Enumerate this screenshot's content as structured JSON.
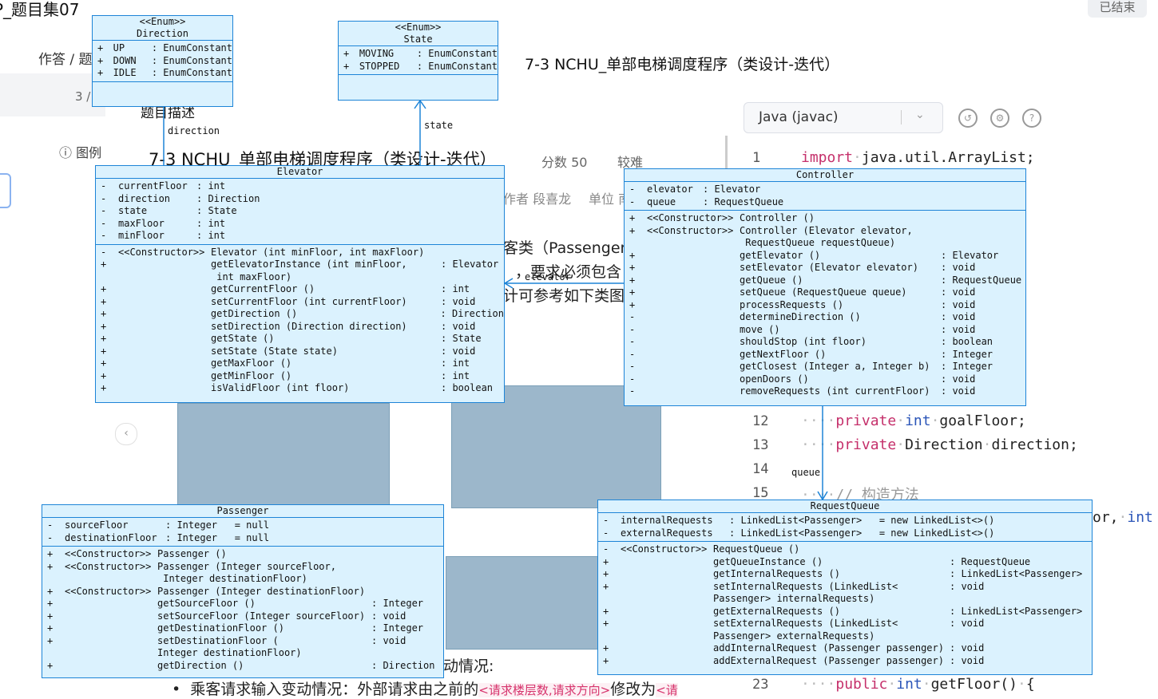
{
  "page": {
    "exam_title": "P_题目集07",
    "ended_label": "已结束",
    "breadcrumb": "作答 / 题",
    "pager": "3 /",
    "example_nav": "图例",
    "heading": "7-3 NCHU_单部电梯调度程序（类设计-迭代）",
    "desc_heading": "题目描述",
    "problem_title": "7-3 NCHU_单部电梯调度程序（类设计-迭代）",
    "score": "分数 50",
    "difficulty": "较难",
    "author": "作者 段喜龙",
    "unit": "单位 南",
    "frag1": "客类（Passenger",
    "frag2": "，要求必须包含",
    "frag3": "计可参考如下类图",
    "frag_dyn": "动情况:",
    "bullet_text": "乘客请求输入变动情况：外部请求由之前的",
    "bullet_tag": "<请求楼层数,请求方向>",
    "bullet_after": "修改为",
    "bullet_tag2": "<请"
  },
  "editor": {
    "language": "Java (javac)",
    "lines": [
      {
        "n": "1",
        "code": "import java.util.ArrayList;"
      },
      {
        "n": "12",
        "code": "private int goalFloor;"
      },
      {
        "n": "13",
        "code": "private Direction direction;"
      },
      {
        "n": "14",
        "code": ""
      },
      {
        "n": "15",
        "code": "// 构造方法"
      },
      {
        "n": "23",
        "code": "public int getFloor() {"
      }
    ],
    "right_frag": "or, int"
  },
  "uml": {
    "direction": {
      "stereotype": "<<Enum>>",
      "name": "Direction",
      "attrs": [
        {
          "v": "+",
          "n": "UP",
          "t": ": EnumConstant"
        },
        {
          "v": "+",
          "n": "DOWN",
          "t": ": EnumConstant"
        },
        {
          "v": "+",
          "n": "IDLE",
          "t": ": EnumConstant"
        }
      ]
    },
    "state": {
      "stereotype": "<<Enum>>",
      "name": "State",
      "attrs": [
        {
          "v": "+",
          "n": "MOVING",
          "t": ": EnumConstant"
        },
        {
          "v": "+",
          "n": "STOPPED",
          "t": ": EnumConstant"
        }
      ]
    },
    "elevator": {
      "name": "Elevator",
      "attrs": [
        {
          "v": "-",
          "n": "currentFloor",
          "t": ": int"
        },
        {
          "v": "-",
          "n": "direction",
          "t": ": Direction"
        },
        {
          "v": "-",
          "n": "state",
          "t": ": State"
        },
        {
          "v": "-",
          "n": "maxFloor",
          "t": ": int"
        },
        {
          "v": "-",
          "n": "minFloor",
          "t": ": int"
        }
      ],
      "methods": [
        {
          "v": "-",
          "m": "<<Constructor>>",
          "s": "Elevator (int minFloor, int maxFloor)",
          "r": ""
        },
        {
          "v": "+",
          "m": "",
          "s": "getElevatorInstance (int minFloor,",
          "r": ": Elevator"
        },
        {
          "v": "",
          "m": "",
          "s": " int maxFloor)",
          "r": ""
        },
        {
          "v": "+",
          "m": "",
          "s": "getCurrentFloor ()",
          "r": ": int"
        },
        {
          "v": "+",
          "m": "",
          "s": "setCurrentFloor (int currentFloor)",
          "r": ": void"
        },
        {
          "v": "+",
          "m": "",
          "s": "getDirection ()",
          "r": ": Direction"
        },
        {
          "v": "+",
          "m": "",
          "s": "setDirection (Direction direction)",
          "r": ": void"
        },
        {
          "v": "+",
          "m": "",
          "s": "getState ()",
          "r": ": State"
        },
        {
          "v": "+",
          "m": "",
          "s": "setState (State state)",
          "r": ": void"
        },
        {
          "v": "+",
          "m": "",
          "s": "getMaxFloor ()",
          "r": ": int"
        },
        {
          "v": "+",
          "m": "",
          "s": "getMinFloor ()",
          "r": ": int"
        },
        {
          "v": "+",
          "m": "",
          "s": "isValidFloor (int floor)",
          "r": ": boolean"
        }
      ]
    },
    "controller": {
      "name": "Controller",
      "attrs": [
        {
          "v": "-",
          "n": "elevator",
          "t": ": Elevator"
        },
        {
          "v": "-",
          "n": "queue",
          "t": ": RequestQueue"
        }
      ],
      "methods": [
        {
          "v": "+",
          "m": "<<Constructor>>",
          "s": "Controller ()",
          "r": ""
        },
        {
          "v": "+",
          "m": "<<Constructor>>",
          "s": "Controller (Elevator elevator,",
          "r": ""
        },
        {
          "v": "",
          "m": "",
          "s": " RequestQueue requestQueue)",
          "r": ""
        },
        {
          "v": "+",
          "m": "",
          "s": "getElevator ()",
          "r": ": Elevator"
        },
        {
          "v": "+",
          "m": "",
          "s": "setElevator (Elevator elevator)",
          "r": ": void"
        },
        {
          "v": "+",
          "m": "",
          "s": "getQueue ()",
          "r": ": RequestQueue"
        },
        {
          "v": "+",
          "m": "",
          "s": "setQueue (RequestQueue queue)",
          "r": ": void"
        },
        {
          "v": "+",
          "m": "",
          "s": "processRequests ()",
          "r": ": void"
        },
        {
          "v": "-",
          "m": "",
          "s": "determineDirection ()",
          "r": ": void"
        },
        {
          "v": "-",
          "m": "",
          "s": "move ()",
          "r": ": void"
        },
        {
          "v": "-",
          "m": "",
          "s": "shouldStop (int floor)",
          "r": ": boolean"
        },
        {
          "v": "-",
          "m": "",
          "s": "getNextFloor ()",
          "r": ": Integer"
        },
        {
          "v": "-",
          "m": "",
          "s": "getClosest (Integer a, Integer b)",
          "r": ": Integer"
        },
        {
          "v": "-",
          "m": "",
          "s": "openDoors ()",
          "r": ": void"
        },
        {
          "v": "-",
          "m": "",
          "s": "removeRequests (int currentFloor)",
          "r": ": void"
        }
      ]
    },
    "passenger": {
      "name": "Passenger",
      "attrs": [
        {
          "v": "-",
          "n": "sourceFloor",
          "t": ": Integer   = null"
        },
        {
          "v": "-",
          "n": "destinationFloor",
          "t": ": Integer   = null"
        }
      ],
      "methods": [
        {
          "v": "+",
          "m": "<<Constructor>>",
          "s": "Passenger ()",
          "r": ""
        },
        {
          "v": "+",
          "m": "<<Constructor>>",
          "s": "Passenger (Integer sourceFloor,",
          "r": ""
        },
        {
          "v": "",
          "m": "",
          "s": " Integer destinationFloor)",
          "r": ""
        },
        {
          "v": "+",
          "m": "<<Constructor>>",
          "s": "Passenger (Integer destinationFloor)",
          "r": ""
        },
        {
          "v": "+",
          "m": "",
          "s": "getSourceFloor ()",
          "r": ": Integer"
        },
        {
          "v": "+",
          "m": "",
          "s": "setSourceFloor (Integer sourceFloor)",
          "r": ": void"
        },
        {
          "v": "+",
          "m": "",
          "s": "getDestinationFloor ()",
          "r": ": Integer"
        },
        {
          "v": "+",
          "m": "",
          "s": "setDestinationFloor (",
          "r": ": void"
        },
        {
          "v": "",
          "m": "",
          "s": "Integer destinationFloor)",
          "r": ""
        },
        {
          "v": "+",
          "m": "",
          "s": "getDirection ()",
          "r": ": Direction"
        }
      ]
    },
    "requestqueue": {
      "name": "RequestQueue",
      "attrs": [
        {
          "v": "-",
          "n": "internalRequests",
          "t": ": LinkedList<Passenger>   = new LinkedList<>()"
        },
        {
          "v": "-",
          "n": "externalRequests",
          "t": ": LinkedList<Passenger>   = new LinkedList<>()"
        }
      ],
      "methods": [
        {
          "v": "-",
          "m": "<<Constructor>>",
          "s": "RequestQueue ()",
          "r": ""
        },
        {
          "v": "+",
          "m": "",
          "s": "getQueueInstance ()",
          "r": ": RequestQueue"
        },
        {
          "v": "+",
          "m": "",
          "s": "getInternalRequests ()",
          "r": ": LinkedList<Passenger>"
        },
        {
          "v": "+",
          "m": "",
          "s": "setInternalRequests (LinkedList<",
          "r": ": void"
        },
        {
          "v": "",
          "m": "",
          "s": "Passenger> internalRequests)",
          "r": ""
        },
        {
          "v": "+",
          "m": "",
          "s": "getExternalRequests ()",
          "r": ": LinkedList<Passenger>"
        },
        {
          "v": "+",
          "m": "",
          "s": "setExternalRequests (LinkedList<",
          "r": ": void"
        },
        {
          "v": "",
          "m": "",
          "s": "Passenger> externalRequests)",
          "r": ""
        },
        {
          "v": "+",
          "m": "",
          "s": "addInternalRequest (Passenger passenger)",
          "r": ": void"
        },
        {
          "v": "+",
          "m": "",
          "s": "addExternalRequest (Passenger passenger)",
          "r": ": void"
        }
      ]
    },
    "connectors": {
      "direction": "direction",
      "state": "state",
      "elevator": "elevator",
      "queue": "queue"
    }
  },
  "colors": {
    "uml_fill": "#dbf2fe",
    "uml_border": "#1d84d7",
    "keyword": "#c5306b",
    "type": "#2b55b8"
  }
}
